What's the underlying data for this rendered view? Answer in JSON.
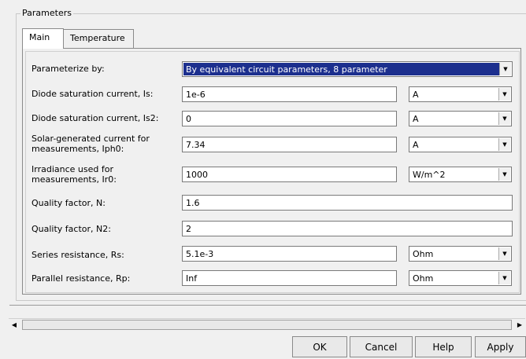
{
  "group_title": "Parameters",
  "tabs": [
    {
      "label": "Main",
      "active": true
    },
    {
      "label": "Temperature",
      "active": false
    }
  ],
  "parameterize": {
    "label": "Parameterize by:",
    "value": "By equivalent circuit parameters, 8 parameter"
  },
  "rows": [
    {
      "label": "Diode saturation current, Is:",
      "value": "1e-6",
      "unit": "A"
    },
    {
      "label": "Diode saturation current, Is2:",
      "value": "0",
      "unit": "A"
    },
    {
      "label": "Solar-generated current for measurements, Iph0:",
      "value": "7.34",
      "unit": "A"
    },
    {
      "label": "Irradiance used for measurements, Ir0:",
      "value": "1000",
      "unit": "W/m^2"
    },
    {
      "label": "Quality factor, N:",
      "value": "1.6"
    },
    {
      "label": "Quality factor, N2:",
      "value": "2"
    },
    {
      "label": "Series resistance, Rs:",
      "value": "5.1e-3",
      "unit": "Ohm"
    },
    {
      "label": "Parallel resistance, Rp:",
      "value": "Inf",
      "unit": "Ohm"
    }
  ],
  "buttons": {
    "ok": "OK",
    "cancel": "Cancel",
    "help": "Help",
    "apply": "Apply"
  },
  "icons": {
    "dropdown": "chevron-down-icon",
    "scroll_left": "arrow-left-icon",
    "scroll_right": "arrow-right-icon"
  }
}
